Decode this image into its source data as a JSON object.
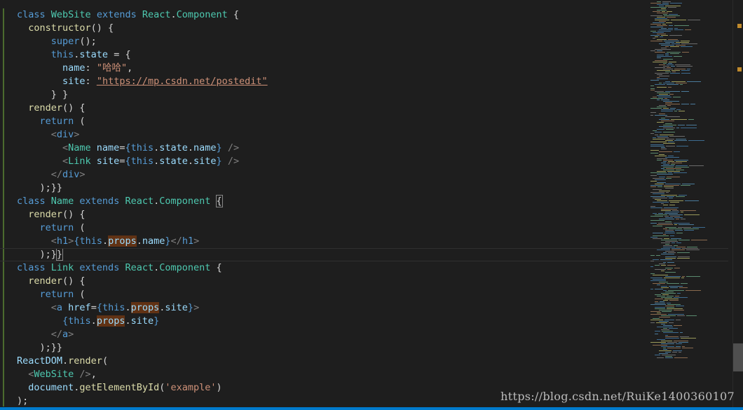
{
  "editor": {
    "watermark": "https://blog.csdn.net/RuiKe1400360107",
    "code_lines": [
      [
        {
          "t": "class ",
          "c": "kw"
        },
        {
          "t": "WebSite ",
          "c": "cls"
        },
        {
          "t": "extends ",
          "c": "kw"
        },
        {
          "t": "React",
          "c": "cls"
        },
        {
          "t": ".",
          "c": "plain"
        },
        {
          "t": "Component",
          "c": "cls"
        },
        {
          "t": " {",
          "c": "plain"
        }
      ],
      [
        {
          "t": "  constructor",
          "c": "fn"
        },
        {
          "t": "() {",
          "c": "plain"
        }
      ],
      [
        {
          "t": "      super",
          "c": "kw"
        },
        {
          "t": "();",
          "c": "plain"
        }
      ],
      [
        {
          "t": "      this",
          "c": "kw"
        },
        {
          "t": ".",
          "c": "plain"
        },
        {
          "t": "state",
          "c": "prop"
        },
        {
          "t": " = {",
          "c": "plain"
        }
      ],
      [
        {
          "t": "        name",
          "c": "prop"
        },
        {
          "t": ": ",
          "c": "plain"
        },
        {
          "t": "\"哈哈\"",
          "c": "str"
        },
        {
          "t": ",",
          "c": "plain"
        }
      ],
      [
        {
          "t": "        site",
          "c": "prop"
        },
        {
          "t": ": ",
          "c": "plain"
        },
        {
          "t": "\"https://mp.csdn.net/postedit\"",
          "c": "str url"
        }
      ],
      [
        {
          "t": "      } }",
          "c": "plain"
        }
      ],
      [
        {
          "t": "  render",
          "c": "fn"
        },
        {
          "t": "() {",
          "c": "plain"
        }
      ],
      [
        {
          "t": "    return ",
          "c": "kw"
        },
        {
          "t": "(",
          "c": "plain"
        }
      ],
      [
        {
          "t": "      <",
          "c": "punct"
        },
        {
          "t": "div",
          "c": "tag"
        },
        {
          "t": ">",
          "c": "punct"
        }
      ],
      [
        {
          "t": "        <",
          "c": "punct"
        },
        {
          "t": "Name ",
          "c": "jsx"
        },
        {
          "t": "name",
          "c": "prop"
        },
        {
          "t": "=",
          "c": "plain"
        },
        {
          "t": "{",
          "c": "kw"
        },
        {
          "t": "this",
          "c": "kw"
        },
        {
          "t": ".",
          "c": "plain"
        },
        {
          "t": "state",
          "c": "prop"
        },
        {
          "t": ".",
          "c": "plain"
        },
        {
          "t": "name",
          "c": "prop"
        },
        {
          "t": "}",
          "c": "kw"
        },
        {
          "t": " />",
          "c": "punct"
        }
      ],
      [
        {
          "t": "        <",
          "c": "punct"
        },
        {
          "t": "Link ",
          "c": "jsx"
        },
        {
          "t": "site",
          "c": "prop"
        },
        {
          "t": "=",
          "c": "plain"
        },
        {
          "t": "{",
          "c": "kw"
        },
        {
          "t": "this",
          "c": "kw"
        },
        {
          "t": ".",
          "c": "plain"
        },
        {
          "t": "state",
          "c": "prop"
        },
        {
          "t": ".",
          "c": "plain"
        },
        {
          "t": "site",
          "c": "prop"
        },
        {
          "t": "}",
          "c": "kw"
        },
        {
          "t": " />",
          "c": "punct"
        }
      ],
      [
        {
          "t": "      </",
          "c": "punct"
        },
        {
          "t": "div",
          "c": "tag"
        },
        {
          "t": ">",
          "c": "punct"
        }
      ],
      [
        {
          "t": "    );}}",
          "c": "plain"
        }
      ],
      [
        {
          "t": "class ",
          "c": "kw"
        },
        {
          "t": "Name ",
          "c": "cls"
        },
        {
          "t": "extends ",
          "c": "kw"
        },
        {
          "t": "React",
          "c": "cls"
        },
        {
          "t": ".",
          "c": "plain"
        },
        {
          "t": "Component",
          "c": "cls"
        },
        {
          "t": " ",
          "c": "plain"
        },
        {
          "t": "{",
          "c": "plain bm"
        }
      ],
      [
        {
          "t": "  render",
          "c": "fn"
        },
        {
          "t": "() {",
          "c": "plain"
        }
      ],
      [
        {
          "t": "    return ",
          "c": "kw"
        },
        {
          "t": "(",
          "c": "plain"
        }
      ],
      [
        {
          "t": "      <",
          "c": "punct"
        },
        {
          "t": "h1",
          "c": "tag"
        },
        {
          "t": ">",
          "c": "punct"
        },
        {
          "t": "{",
          "c": "kw"
        },
        {
          "t": "this",
          "c": "kw"
        },
        {
          "t": ".",
          "c": "plain"
        },
        {
          "t": "props",
          "c": "prop hl"
        },
        {
          "t": ".",
          "c": "plain"
        },
        {
          "t": "name",
          "c": "prop"
        },
        {
          "t": "}",
          "c": "kw"
        },
        {
          "t": "</",
          "c": "punct"
        },
        {
          "t": "h1",
          "c": "tag"
        },
        {
          "t": ">",
          "c": "punct"
        }
      ],
      [
        {
          "t": "    );}",
          "c": "plain"
        },
        {
          "t": "}",
          "c": "plain bm"
        }
      ],
      [
        {
          "t": "class ",
          "c": "kw"
        },
        {
          "t": "Link ",
          "c": "cls"
        },
        {
          "t": "extends ",
          "c": "kw"
        },
        {
          "t": "React",
          "c": "cls"
        },
        {
          "t": ".",
          "c": "plain"
        },
        {
          "t": "Component",
          "c": "cls"
        },
        {
          "t": " {",
          "c": "plain"
        }
      ],
      [
        {
          "t": "  render",
          "c": "fn"
        },
        {
          "t": "() {",
          "c": "plain"
        }
      ],
      [
        {
          "t": "    return ",
          "c": "kw"
        },
        {
          "t": "(",
          "c": "plain"
        }
      ],
      [
        {
          "t": "      <",
          "c": "punct"
        },
        {
          "t": "a ",
          "c": "tag"
        },
        {
          "t": "href",
          "c": "prop"
        },
        {
          "t": "=",
          "c": "plain"
        },
        {
          "t": "{",
          "c": "kw"
        },
        {
          "t": "this",
          "c": "kw"
        },
        {
          "t": ".",
          "c": "plain"
        },
        {
          "t": "props",
          "c": "prop hl"
        },
        {
          "t": ".",
          "c": "plain"
        },
        {
          "t": "site",
          "c": "prop"
        },
        {
          "t": "}",
          "c": "kw"
        },
        {
          "t": ">",
          "c": "punct"
        }
      ],
      [
        {
          "t": "        {",
          "c": "kw"
        },
        {
          "t": "this",
          "c": "kw"
        },
        {
          "t": ".",
          "c": "plain"
        },
        {
          "t": "props",
          "c": "prop hl"
        },
        {
          "t": ".",
          "c": "plain"
        },
        {
          "t": "site",
          "c": "prop"
        },
        {
          "t": "}",
          "c": "kw"
        }
      ],
      [
        {
          "t": "      </",
          "c": "punct"
        },
        {
          "t": "a",
          "c": "tag"
        },
        {
          "t": ">",
          "c": "punct"
        }
      ],
      [
        {
          "t": "    );}}",
          "c": "plain"
        }
      ],
      [
        {
          "t": "ReactDOM",
          "c": "prop"
        },
        {
          "t": ".",
          "c": "plain"
        },
        {
          "t": "render",
          "c": "fn"
        },
        {
          "t": "(",
          "c": "plain"
        }
      ],
      [
        {
          "t": "  <",
          "c": "punct"
        },
        {
          "t": "WebSite",
          "c": "jsx"
        },
        {
          "t": " />",
          "c": "punct"
        },
        {
          "t": ",",
          "c": "plain"
        }
      ],
      [
        {
          "t": "  document",
          "c": "prop"
        },
        {
          "t": ".",
          "c": "plain"
        },
        {
          "t": "getElementById",
          "c": "fn"
        },
        {
          "t": "(",
          "c": "plain"
        },
        {
          "t": "'example'",
          "c": "str"
        },
        {
          "t": ")",
          "c": "plain"
        }
      ],
      [
        {
          "t": ");",
          "c": "plain"
        }
      ]
    ]
  }
}
